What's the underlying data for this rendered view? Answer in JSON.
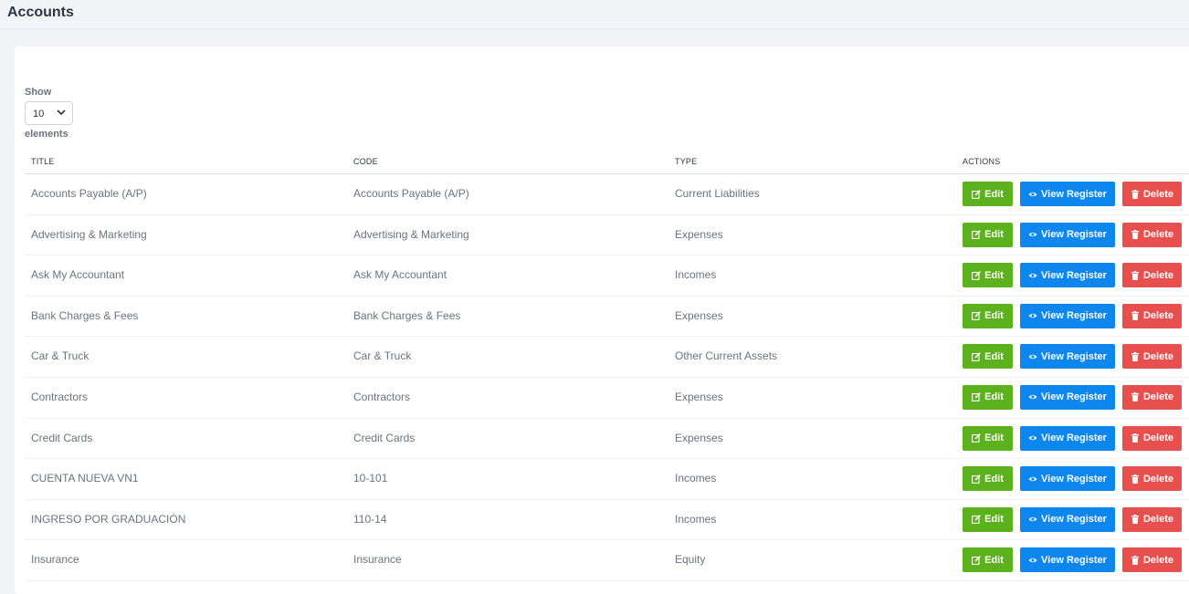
{
  "page": {
    "title": "Accounts"
  },
  "length_control": {
    "show_label": "Show",
    "selected": "10",
    "elements_label": "elements"
  },
  "table": {
    "headers": {
      "title": "TITLE",
      "code": "CODE",
      "type": "TYPE",
      "actions": "ACTIONS"
    },
    "buttons": {
      "edit": "Edit",
      "view": "View Register",
      "delete": "Delete"
    },
    "rows": [
      {
        "title": "Accounts Payable (A/P)",
        "code": "Accounts Payable (A/P)",
        "type": "Current Liabilities"
      },
      {
        "title": "Advertising & Marketing",
        "code": "Advertising & Marketing",
        "type": "Expenses"
      },
      {
        "title": "Ask My Accountant",
        "code": "Ask My Accountant",
        "type": "Incomes"
      },
      {
        "title": "Bank Charges & Fees",
        "code": "Bank Charges & Fees",
        "type": "Expenses"
      },
      {
        "title": "Car & Truck",
        "code": "Car & Truck",
        "type": "Other Current Assets"
      },
      {
        "title": "Contractors",
        "code": "Contractors",
        "type": "Expenses"
      },
      {
        "title": "Credit Cards",
        "code": "Credit Cards",
        "type": "Expenses"
      },
      {
        "title": "CUENTA NUEVA VN1",
        "code": "10-101",
        "type": "Incomes"
      },
      {
        "title": "INGRESO POR GRADUACIÓN",
        "code": "110-14",
        "type": "Incomes"
      },
      {
        "title": "Insurance",
        "code": "Insurance",
        "type": "Equity"
      }
    ]
  },
  "colors": {
    "edit": "#5cb21c",
    "view": "#0d86ee",
    "delete": "#e8504f"
  },
  "icons": {
    "edit": "edit-icon",
    "view": "eye-icon",
    "delete": "trash-icon",
    "select": "chevron-down-icon"
  }
}
